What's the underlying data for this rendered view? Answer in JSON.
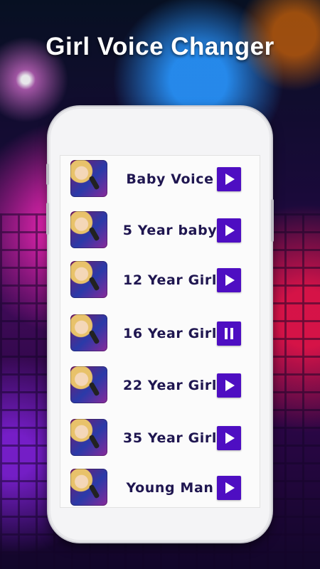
{
  "app": {
    "title": "Girl Voice Changer"
  },
  "voices": [
    {
      "label": "Baby Voice",
      "state": "play"
    },
    {
      "label": "5 Year baby",
      "state": "play"
    },
    {
      "label": "12 Year Girl",
      "state": "play"
    },
    {
      "label": "16 Year Girl",
      "state": "pause"
    },
    {
      "label": "22 Year Girl",
      "state": "play"
    },
    {
      "label": "35 Year Girl",
      "state": "play"
    },
    {
      "label": "Young Man",
      "state": "play"
    }
  ],
  "colors": {
    "accent": "#4e0ec2",
    "label_text": "#1f1650",
    "screen_bg": "#fbfbfb"
  },
  "icons": {
    "play": "play-icon",
    "pause": "pause-icon",
    "thumbnail": "singer-thumbnail"
  }
}
